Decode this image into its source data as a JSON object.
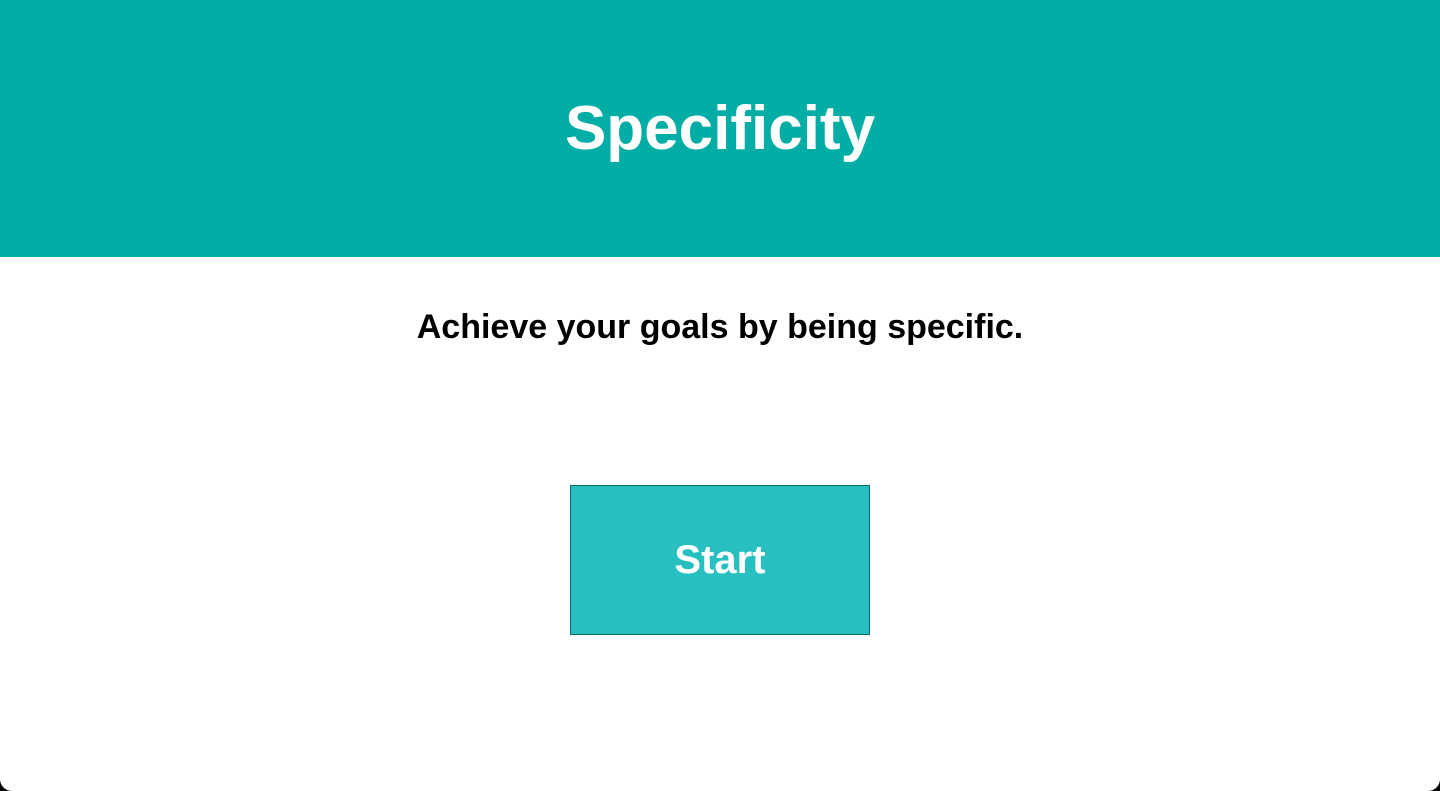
{
  "app": {
    "title": "Specificity"
  },
  "main": {
    "tagline": "Achieve your goals by being specific.",
    "start_label": "Start"
  },
  "colors": {
    "header_background": "#02ada5",
    "button_background": "#27bfbf",
    "button_border": "#066b6b",
    "text_dark": "#000000",
    "text_light": "#ffffff"
  }
}
